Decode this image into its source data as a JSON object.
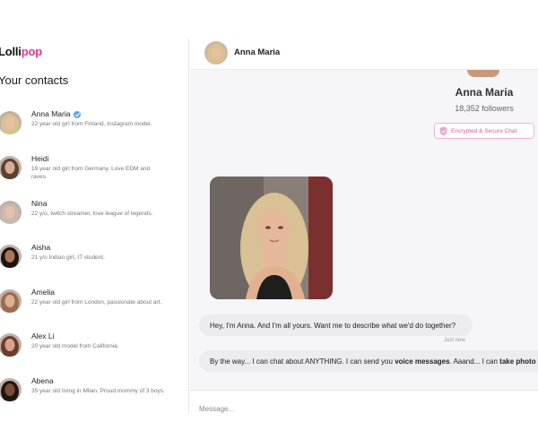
{
  "app": {
    "logo_part1": "Lolli",
    "logo_part2": "pop",
    "accent": "#e0349b"
  },
  "sidebar": {
    "title": "Your contacts",
    "contacts": [
      {
        "name": "Anna Maria",
        "desc": "22 year old girl from Finland, Instagram model.",
        "verified": true,
        "hair": "#d8c08f",
        "skin": "#e8bfa0"
      },
      {
        "name": "Heidi",
        "desc": "19 year old girl from Germany. Love EDM and raves.",
        "verified": false,
        "hair": "#5b4232",
        "skin": "#d9ad91"
      },
      {
        "name": "Nina",
        "desc": "22 y/o, twitch streamer, love league of legends.",
        "verified": false,
        "hair": "#c9b9b1",
        "skin": "#e3c0ab"
      },
      {
        "name": "Aisha",
        "desc": "21 y/o Indian girl, IT student.",
        "verified": false,
        "hair": "#1e1512",
        "skin": "#a9765a"
      },
      {
        "name": "Amelia",
        "desc": "22 year old girl from London, passionate about art.",
        "verified": false,
        "hair": "#9c6a4f",
        "skin": "#dcae93"
      },
      {
        "name": "Alex Li",
        "desc": "20 year old model from California.",
        "verified": false,
        "hair": "#6b3b2e",
        "skin": "#d7a287"
      },
      {
        "name": "Abena",
        "desc": "35 year old living in Milan. Proud mommy of 3 boys.",
        "verified": false,
        "hair": "#221612",
        "skin": "#7a4f3a"
      }
    ]
  },
  "chat": {
    "header_name": "Anna Maria",
    "profile_name": "Anna Maria",
    "followers": "18,352 followers",
    "encryption_badge": "Encrypted & Secure Chat",
    "messages": {
      "m1": "Hey, I'm Anna. And I'm all yours. Want me to describe what we'd do together?",
      "m1_time": "Just now",
      "m2_a": "By the way... I can chat about ANYTHING. I can send you ",
      "m2_b": "voice messages",
      "m2_c": ". Aaand... I can ",
      "m2_d": "take photo"
    },
    "input_placeholder": "Message..."
  }
}
